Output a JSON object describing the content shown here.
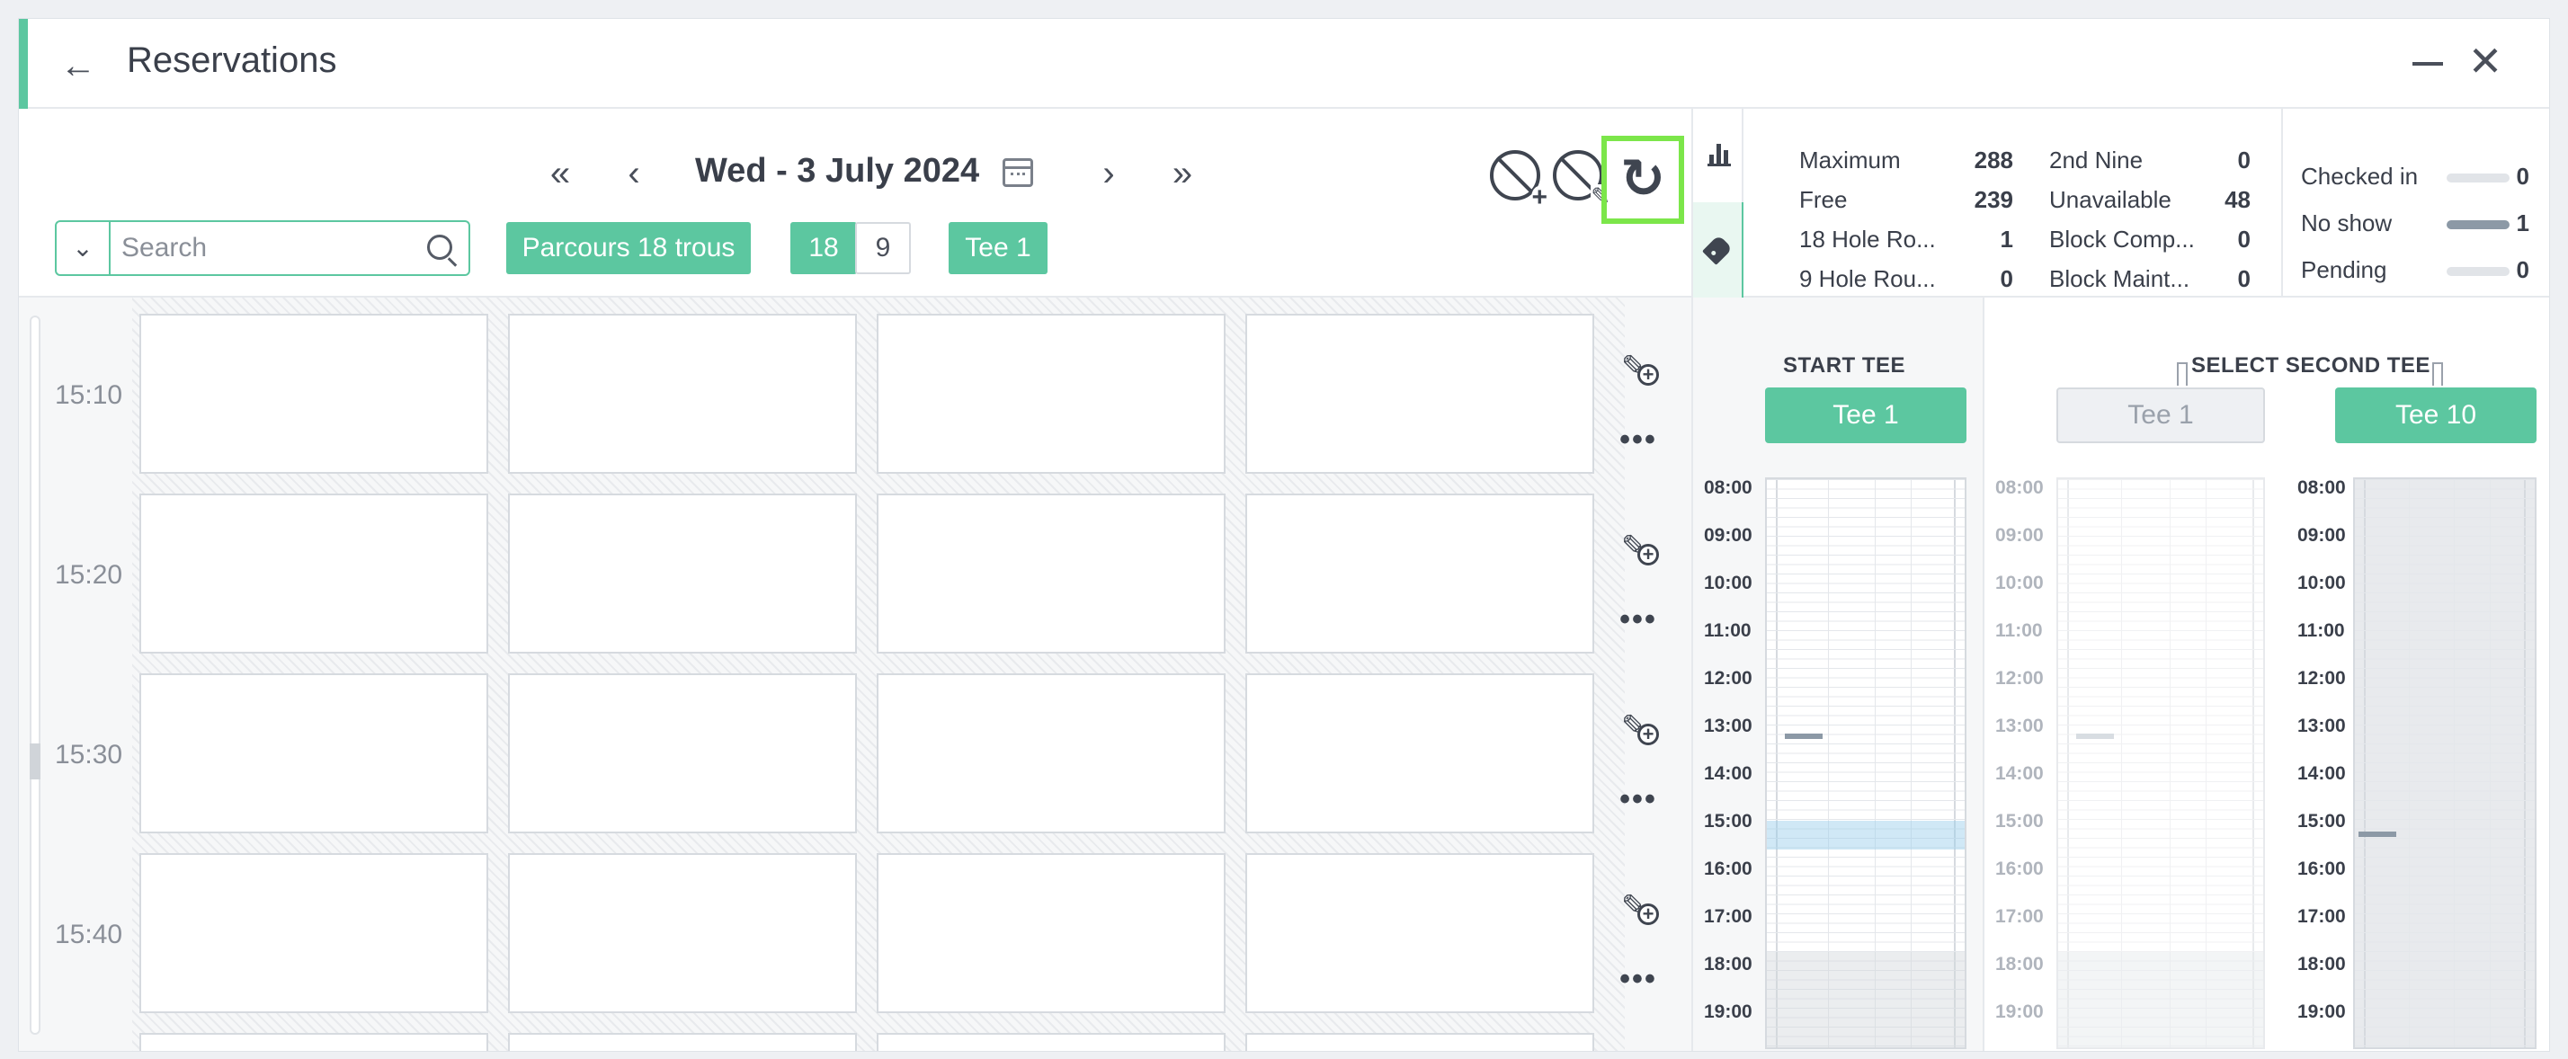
{
  "window": {
    "title": "Reservations"
  },
  "toolbar": {
    "date": "Wed - 3 July 2024",
    "search_placeholder": "Search",
    "course_chip": "Parcours 18 trous",
    "holes": [
      "18",
      "9"
    ],
    "tee_chip": "Tee 1"
  },
  "stats": {
    "rows": [
      {
        "label": "Maximum",
        "value": "288",
        "label2": "2nd Nine",
        "value2": "0"
      },
      {
        "label": "Free",
        "value": "239",
        "label2": "Unavailable",
        "value2": "48"
      },
      {
        "label": "18 Hole Ro...",
        "value": "1",
        "label2": "Block Comp...",
        "value2": "0"
      },
      {
        "label": "9 Hole Rou...",
        "value": "0",
        "label2": "Block Maint...",
        "value2": "0"
      }
    ],
    "status": [
      {
        "label": "Checked in",
        "value": "0",
        "level": 0
      },
      {
        "label": "No show",
        "value": "1",
        "level": 1
      },
      {
        "label": "Pending",
        "value": "0",
        "level": 0
      }
    ]
  },
  "grid": {
    "times": [
      "15:10",
      "15:20",
      "15:30",
      "15:40"
    ]
  },
  "tee_panel": {
    "start_heading": "START TEE",
    "second_heading": "SELECT SECOND TEE",
    "start_tee": "Tee 1",
    "second_tee_a": "Tee 1",
    "second_tee_b": "Tee 10",
    "hours": [
      "08:00",
      "09:00",
      "10:00",
      "11:00",
      "12:00",
      "13:00",
      "14:00",
      "15:00",
      "16:00",
      "17:00",
      "18:00",
      "19:00"
    ]
  },
  "colors": {
    "accent": "#5cc7a0",
    "highlight_box": "#7ce64a"
  },
  "icons": [
    "back-arrow-icon",
    "minimize-icon",
    "close-icon",
    "double-chevron-left-icon",
    "chevron-left-icon",
    "calendar-icon",
    "chevron-right-icon",
    "double-chevron-right-icon",
    "block-add-icon",
    "block-edit-icon",
    "refresh-icon",
    "search-icon",
    "bar-chart-icon",
    "tag-icon",
    "pen-plus-icon",
    "more-icon"
  ]
}
